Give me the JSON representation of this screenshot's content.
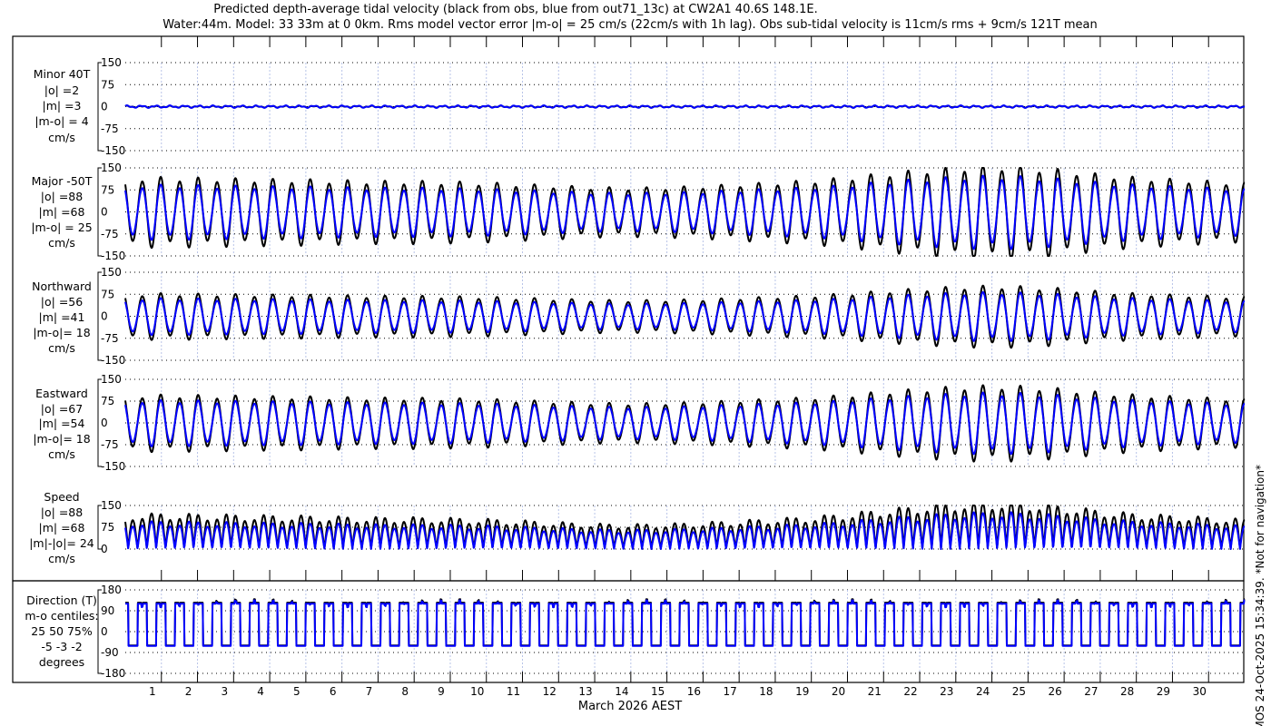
{
  "title_line1": "Predicted depth-average tidal velocity (black from obs, blue from out71_13c) at CW2A1 40.6S 148.1E.",
  "title_line2": "Water:44m. Model: 33 33m at 0 0km. Rms model vector error |m-o| = 25 cm/s (22cm/s with 1h lag). Obs sub-tidal velocity is 11cm/s rms + 9cm/s 121T mean",
  "xlabel": "March 2026 AEST",
  "copyright": "© IMOS 24-Oct-2025 15:34:39. *Not for navigation*",
  "colors": {
    "obs": "#000000",
    "model": "#0000ff",
    "grid": "#000000",
    "day_grid": "#b8c4e8"
  },
  "chart_data": {
    "type": "line",
    "x_tick_labels": [
      "1",
      "2",
      "3",
      "4",
      "5",
      "6",
      "7",
      "8",
      "9",
      "10",
      "11",
      "12",
      "13",
      "14",
      "15",
      "16",
      "17",
      "18",
      "19",
      "20",
      "21",
      "22",
      "23",
      "24",
      "25",
      "26",
      "27",
      "28",
      "29",
      "30"
    ],
    "x_range_days": [
      0,
      31
    ],
    "daily_obs_major_amplitude": [
      110,
      112,
      110,
      108,
      106,
      105,
      102,
      100,
      100,
      98,
      95,
      90,
      85,
      80,
      78,
      80,
      84,
      90,
      96,
      102,
      112,
      125,
      136,
      145,
      150,
      146,
      136,
      122,
      112,
      106,
      100
    ],
    "model_to_obs_ratio": 0.78,
    "panels": [
      {
        "name": "minor",
        "labels": [
          "Minor 40T",
          "|o| =2",
          "|m| =3",
          "|m-o| = 4",
          "cm/s"
        ],
        "ticks": [
          150,
          75,
          0,
          -75,
          -150
        ],
        "tick_labels": [
          "150",
          "75",
          "0",
          "-75",
          "-150"
        ],
        "ylim": [
          -150,
          150
        ],
        "obs_scale": 0.02,
        "model_scale": 0.03
      },
      {
        "name": "major",
        "labels": [
          "Major -50T",
          "|o| =88",
          "|m| =68",
          "|m-o| = 25",
          "cm/s"
        ],
        "ticks": [
          150,
          75,
          0,
          -75,
          -150
        ],
        "tick_labels": [
          "150",
          "75",
          "0",
          "-75",
          "-150"
        ],
        "ylim": [
          -150,
          150
        ],
        "obs_scale": 1.0,
        "model_scale": 0.78
      },
      {
        "name": "northward",
        "labels": [
          "Northward",
          "|o| =56",
          "|m| =41",
          "|m-o|= 18",
          "cm/s"
        ],
        "ticks": [
          150,
          75,
          0,
          -75,
          -150
        ],
        "tick_labels": [
          "150",
          "75",
          "0",
          "-75",
          "-150"
        ],
        "ylim": [
          -150,
          150
        ],
        "obs_scale": 0.66,
        "model_scale": 0.52
      },
      {
        "name": "eastward",
        "labels": [
          "Eastward",
          "|o| =67",
          "|m| =54",
          "|m-o|= 18",
          "cm/s"
        ],
        "ticks": [
          150,
          75,
          0,
          -75,
          -150
        ],
        "tick_labels": [
          "150",
          "75",
          "0",
          "-75",
          "-150"
        ],
        "ylim": [
          -150,
          150
        ],
        "obs_scale": 0.82,
        "model_scale": 0.66
      },
      {
        "name": "speed",
        "labels": [
          "Speed",
          "|o| =88",
          "|m| =68",
          "|m|-|o|= 24",
          "cm/s"
        ],
        "ticks": [
          150,
          75,
          0
        ],
        "tick_labels": [
          "150",
          "75",
          "0"
        ],
        "ylim": [
          0,
          150
        ],
        "obs_scale": 1.0,
        "model_scale": 0.78
      },
      {
        "name": "direction",
        "labels": [
          "Direction (T)",
          "m-o centiles:",
          "25  50  75%",
          "-5 -3 -2",
          "degrees"
        ],
        "ticks": [
          180,
          90,
          0,
          -90,
          -180
        ],
        "tick_labels": [
          "180",
          "90",
          "0",
          "-90",
          "-180"
        ],
        "ylim": [
          -180,
          180
        ],
        "obs_flood_dir": 125,
        "obs_ebb_dir": -60,
        "model_flood_dir": 120,
        "model_ebb_dir": -62
      }
    ]
  }
}
